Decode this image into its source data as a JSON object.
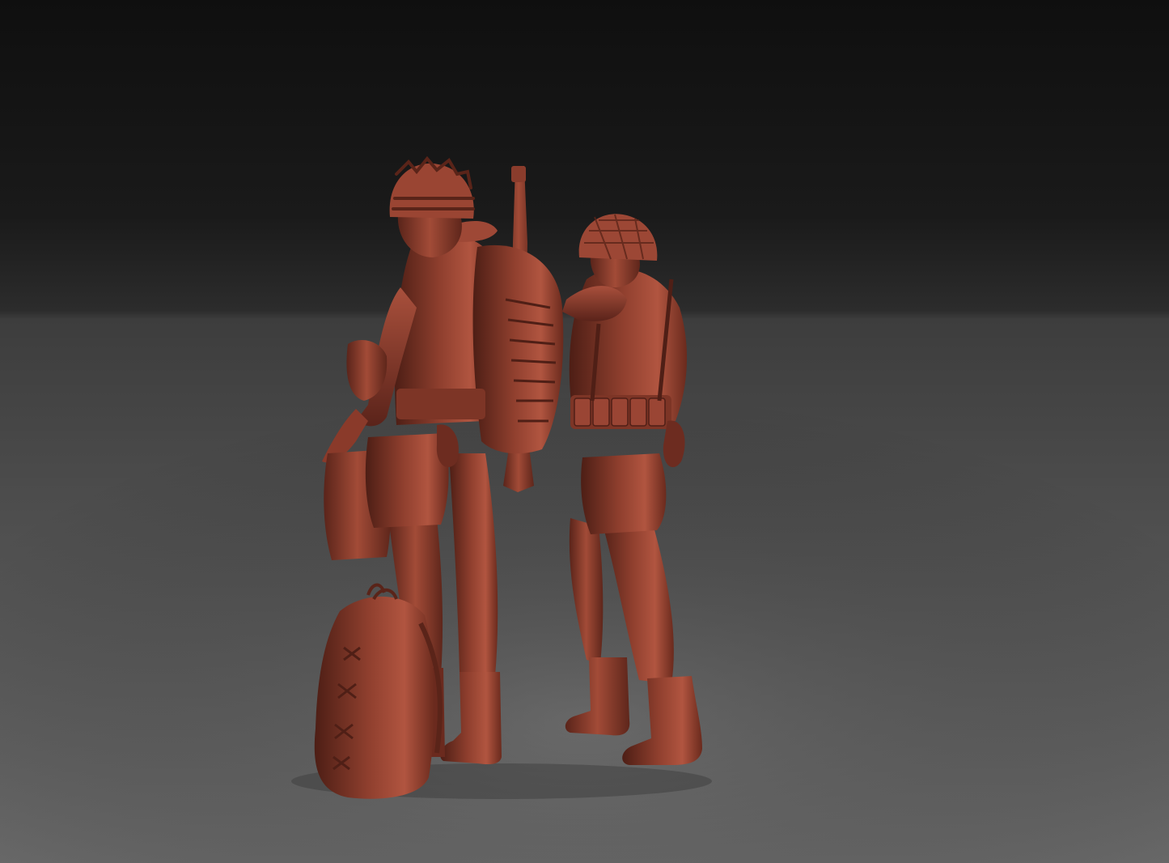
{
  "scene": {
    "description_visible_text": "",
    "colors": {
      "backdrop_top": "#121212",
      "backdrop_horizon": "#3a3a3a",
      "floor_near": "#6e6e6e",
      "floor_far": "#4a4a4a",
      "figure_base": "#8a3c2c",
      "figure_light": "#b5573f",
      "figure_shadow": "#4a1d14",
      "figure_mid": "#9a4633"
    },
    "objects": [
      {
        "name": "soldier-left",
        "kind": "figure"
      },
      {
        "name": "soldier-right",
        "kind": "figure"
      },
      {
        "name": "duffel-bag",
        "kind": "prop"
      },
      {
        "name": "rifle",
        "kind": "prop"
      }
    ]
  }
}
